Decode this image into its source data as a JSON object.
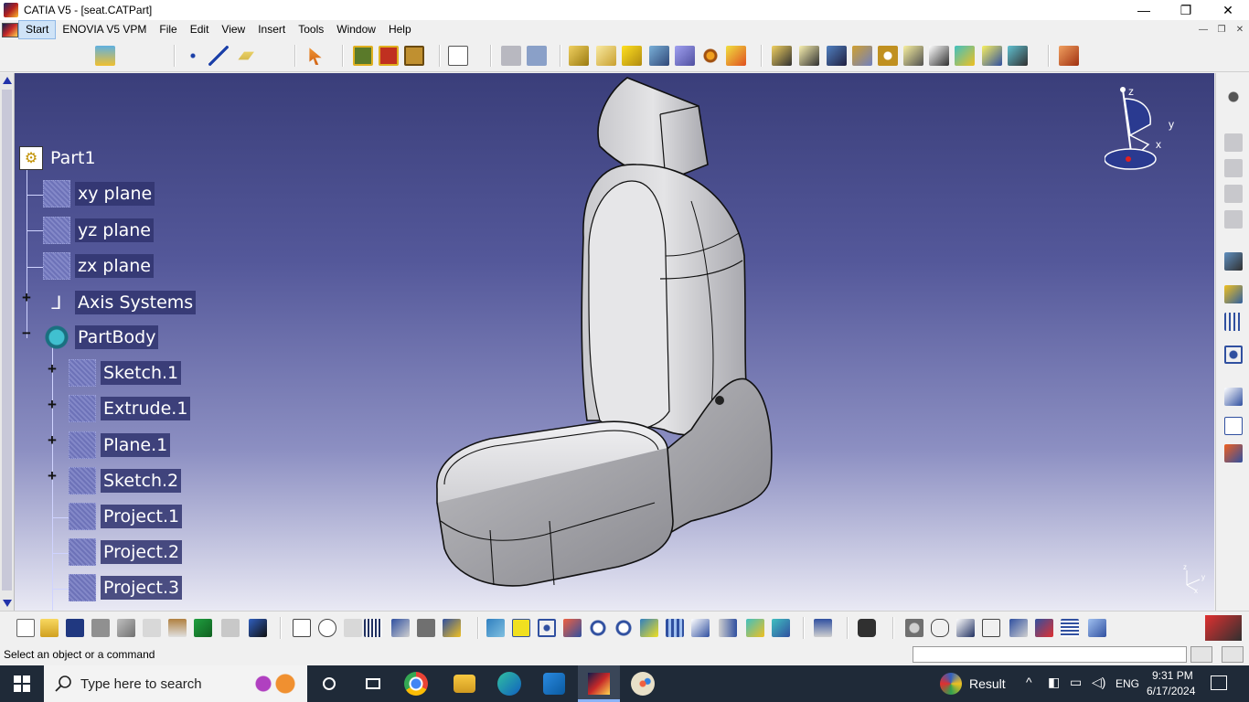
{
  "window": {
    "title": "CATIA V5 - [seat.CATPart]",
    "minimize": "—",
    "maximize": "❐",
    "close": "✕"
  },
  "menu": {
    "items": [
      "Start",
      "ENOVIA V5 VPM",
      "File",
      "Edit",
      "View",
      "Insert",
      "Tools",
      "Window",
      "Help"
    ]
  },
  "tree": {
    "nodes": [
      {
        "label": "Part1",
        "icon": "part-icon"
      },
      {
        "label": "xy plane",
        "icon": "plane-icon"
      },
      {
        "label": "yz plane",
        "icon": "plane-icon"
      },
      {
        "label": "zx plane",
        "icon": "plane-icon"
      },
      {
        "label": "Axis Systems",
        "icon": "axis-system-icon"
      },
      {
        "label": "PartBody",
        "icon": "body-icon"
      },
      {
        "label": "Sketch.1",
        "icon": "sketch-icon"
      },
      {
        "label": "Extrude.1",
        "icon": "extrude-icon"
      },
      {
        "label": "Plane.1",
        "icon": "plane-icon"
      },
      {
        "label": "Sketch.2",
        "icon": "sketch-icon"
      },
      {
        "label": "Project.1",
        "icon": "project-icon"
      },
      {
        "label": "Project.2",
        "icon": "project-icon"
      },
      {
        "label": "Project.3",
        "icon": "project-icon"
      }
    ]
  },
  "compass": {
    "z": "z",
    "y": "y",
    "x": "x"
  },
  "corner_axis": {
    "z": "z",
    "y": "y",
    "x": "x"
  },
  "status": {
    "message": "Select an object or a command",
    "command_input": ""
  },
  "taskbar": {
    "search_placeholder": "Type here to search",
    "result_label": "Result",
    "language": "ENG",
    "time": "9:31 PM",
    "date": "6/17/2024"
  },
  "colors": {
    "viewport_top": "#3a3e7a",
    "viewport_bottom": "#e9e9f4",
    "tree_label_bg": "#30346e",
    "model_fill": "#d7d7d9"
  }
}
